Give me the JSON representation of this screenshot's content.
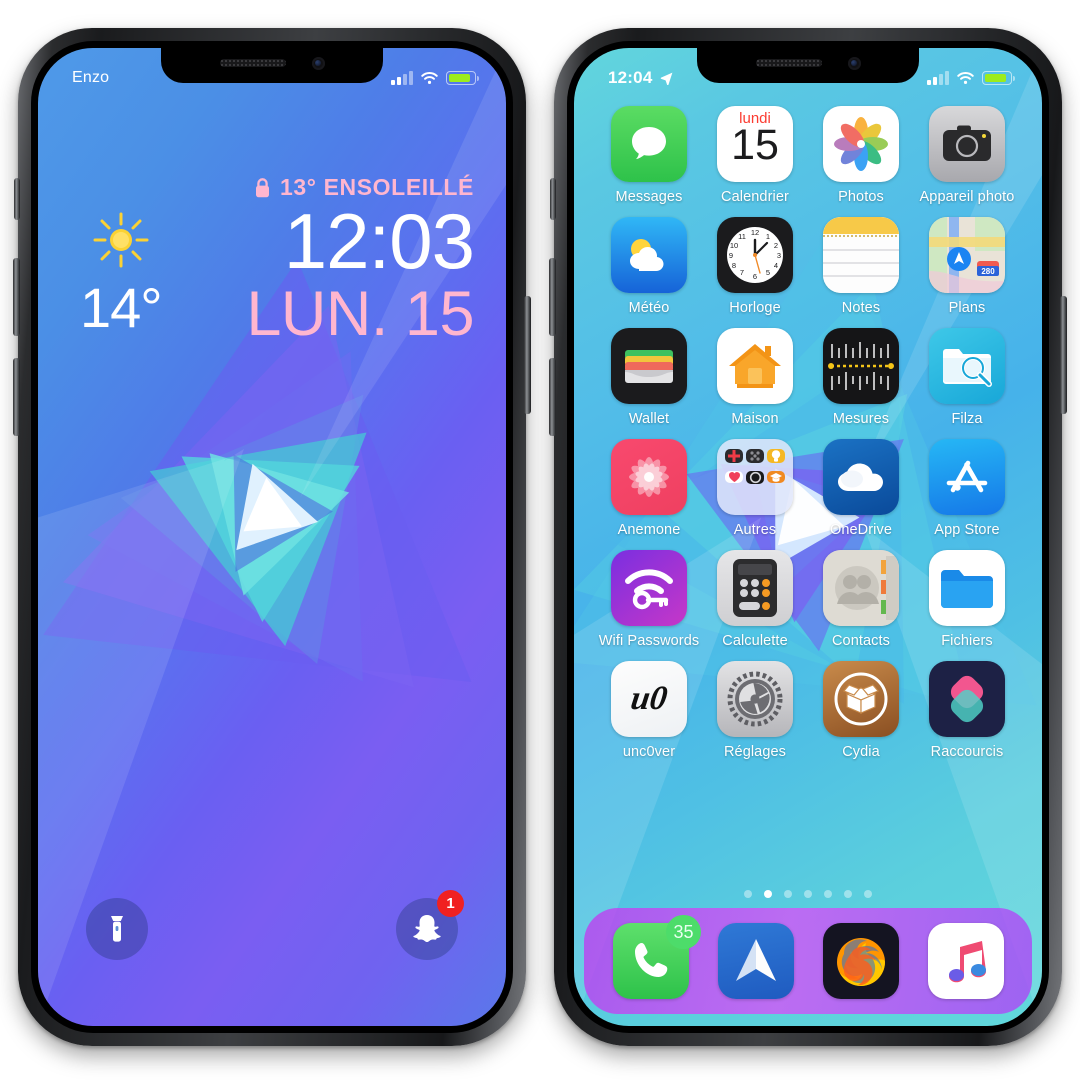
{
  "lock_screen": {
    "statusbar": {
      "carrier": "Enzo",
      "signal_icon": "cellular-bars-icon",
      "wifi_icon": "wifi-icon",
      "battery_icon": "battery-icon"
    },
    "weather_banner": {
      "lock_icon": "lock-icon",
      "text": "13° ENSOLEILLÉ",
      "color": "#ffb6cf"
    },
    "time": "12:03",
    "date": "LUN. 15",
    "weather_widget": {
      "icon": "sun-icon",
      "temperature": "14°"
    },
    "left_action": {
      "icon": "flashlight-icon",
      "name": "flashlight-button"
    },
    "right_action": {
      "icon": "snapchat-ghost-icon",
      "name": "snapchat-button",
      "badge": "1"
    }
  },
  "home_screen": {
    "statusbar": {
      "time": "12:04",
      "location_icon": "location-arrow-icon",
      "signal_icon": "cellular-bars-icon",
      "wifi_icon": "wifi-icon",
      "battery_icon": "battery-icon"
    },
    "apps": [
      {
        "label": "Messages",
        "icon": "messages-icon"
      },
      {
        "label": "Calendrier",
        "icon": "calendar-icon",
        "day_of_week": "lundi",
        "day": "15"
      },
      {
        "label": "Photos",
        "icon": "photos-icon"
      },
      {
        "label": "Appareil photo",
        "icon": "camera-icon"
      },
      {
        "label": "Météo",
        "icon": "weather-icon"
      },
      {
        "label": "Horloge",
        "icon": "clock-icon"
      },
      {
        "label": "Notes",
        "icon": "notes-icon"
      },
      {
        "label": "Plans",
        "icon": "maps-icon",
        "shield": "280"
      },
      {
        "label": "Wallet",
        "icon": "wallet-icon"
      },
      {
        "label": "Maison",
        "icon": "home-app-icon"
      },
      {
        "label": "Mesures",
        "icon": "measure-icon"
      },
      {
        "label": "Filza",
        "icon": "filza-icon"
      },
      {
        "label": "Anemone",
        "icon": "anemone-flower-icon"
      },
      {
        "label": "Autres",
        "icon": "folder-icon"
      },
      {
        "label": "OneDrive",
        "icon": "onedrive-cloud-icon"
      },
      {
        "label": "App Store",
        "icon": "app-store-icon"
      },
      {
        "label": "Wifi Passwords",
        "icon": "wifi-key-icon"
      },
      {
        "label": "Calculette",
        "icon": "calculator-icon"
      },
      {
        "label": "Contacts",
        "icon": "contacts-icon"
      },
      {
        "label": "Fichiers",
        "icon": "files-folder-icon"
      },
      {
        "label": "unc0ver",
        "icon": "uncover-icon",
        "glyph": "u0"
      },
      {
        "label": "Réglages",
        "icon": "settings-gear-icon"
      },
      {
        "label": "Cydia",
        "icon": "cydia-box-icon"
      },
      {
        "label": "Raccourcis",
        "icon": "shortcuts-icon"
      }
    ],
    "page_dots": {
      "count": 7,
      "active_index": 1
    },
    "dock": [
      {
        "label": "Phone",
        "icon": "phone-handset-icon",
        "badge": "35"
      },
      {
        "label": "Spark",
        "icon": "spark-mail-icon"
      },
      {
        "label": "Firefox",
        "icon": "firefox-icon"
      },
      {
        "label": "Musique",
        "icon": "music-note-icon"
      }
    ]
  },
  "colors": {
    "pink_accent": "#ffb6cf",
    "dock_purple": "#ba42f0",
    "badge_red": "#f02121",
    "badge_green": "#4ddc6a",
    "battery_green": "#9dec1c"
  }
}
